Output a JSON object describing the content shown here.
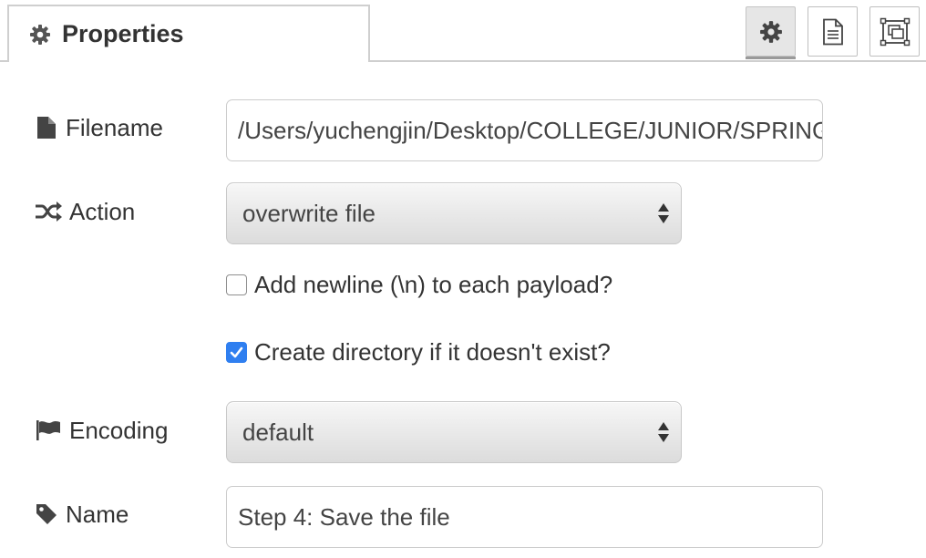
{
  "tab": {
    "label": "Properties",
    "icon": "gear-icon"
  },
  "header_buttons": [
    {
      "name": "node-settings",
      "icon": "gear-icon",
      "active": true
    },
    {
      "name": "node-description",
      "icon": "document-icon",
      "active": false
    },
    {
      "name": "node-appearance",
      "icon": "appearance-icon",
      "active": false
    }
  ],
  "form": {
    "filename": {
      "label": "Filename",
      "icon": "file-icon",
      "value": "/Users/yuchengjin/Desktop/COLLEGE/JUNIOR/SPRING"
    },
    "action": {
      "label": "Action",
      "icon": "shuffle-icon",
      "value": "overwrite file"
    },
    "add_newline": {
      "label": "Add newline (\\n) to each payload?",
      "checked": false
    },
    "create_dir": {
      "label": "Create directory if it doesn't exist?",
      "checked": true
    },
    "encoding": {
      "label": "Encoding",
      "icon": "flag-icon",
      "value": "default"
    },
    "name": {
      "label": "Name",
      "icon": "tag-icon",
      "value": "Step 4: Save the file"
    }
  },
  "colors": {
    "accent": "#2f7ff0",
    "text": "#333333",
    "border": "#cccccc"
  }
}
